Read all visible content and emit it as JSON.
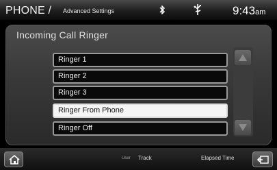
{
  "header": {
    "title": "PHONE /",
    "subtitle": "Advanced Settings",
    "bluetooth_icon": "bluetooth-icon",
    "sync_icon": "sync-icon",
    "time": "9:43",
    "ampm": "am"
  },
  "panel": {
    "title": "Incoming Call Ringer",
    "items": [
      {
        "label": "Ringer 1",
        "selected": false
      },
      {
        "label": "Ringer 2",
        "selected": false
      },
      {
        "label": "Ringer 3",
        "selected": false
      },
      {
        "label": "Ringer From Phone",
        "selected": true
      },
      {
        "label": "Ringer Off",
        "selected": false
      }
    ],
    "scroll_up_icon": "arrow-up-icon",
    "scroll_down_icon": "arrow-down-icon"
  },
  "footer": {
    "home_icon": "home-icon",
    "user_label": "User",
    "track_label": "Track",
    "elapsed_label": "Elapsed Time",
    "back_icon": "back-icon"
  }
}
